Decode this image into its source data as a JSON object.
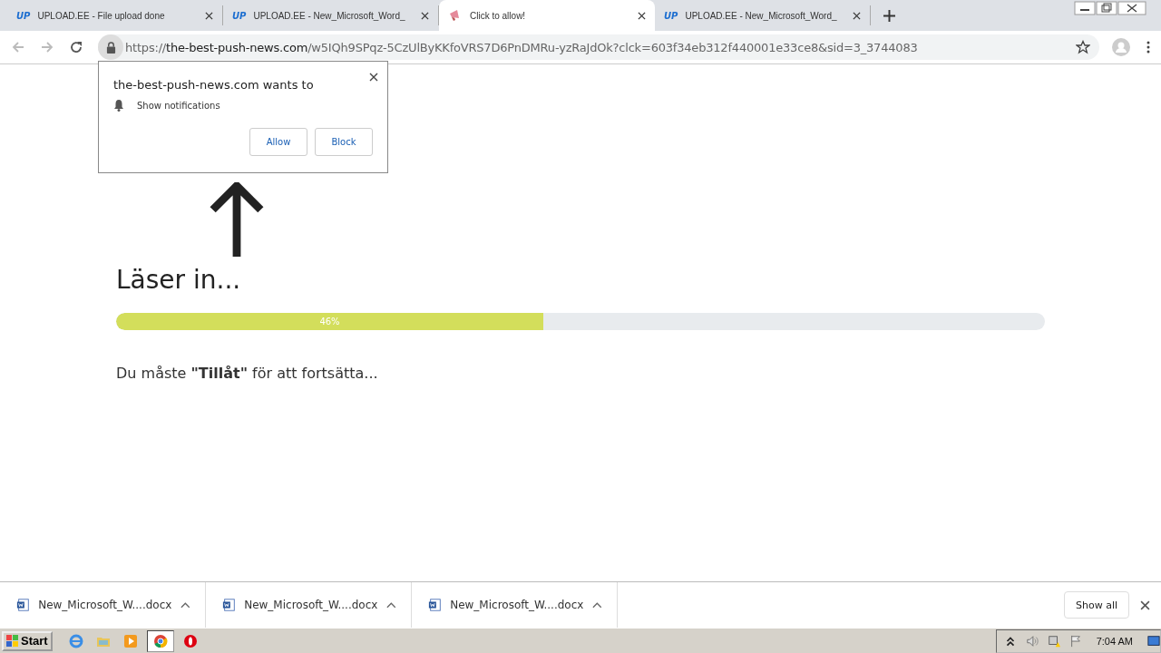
{
  "tabs": [
    {
      "badge": "UP",
      "title": "UPLOAD.EE - File upload done",
      "selected": false
    },
    {
      "badge": "UP",
      "title": "UPLOAD.EE - New_Microsoft_Word_",
      "selected": false
    },
    {
      "title": "Click to allow!",
      "selected": true
    },
    {
      "badge": "UP",
      "title": "UPLOAD.EE - New_Microsoft_Word_",
      "selected": false
    }
  ],
  "address_bar": {
    "scheme": "https://",
    "host": "the-best-push-news.com",
    "path": "/w5IQh9SPqz-5CzUlByKKfoVRS7D6PnDMRu-yzRaJdOk?clck=603f34eb312f440001e33ce8&sid=3_3744083"
  },
  "permission_prompt": {
    "title": "the-best-push-news.com wants to",
    "permission": "Show notifications",
    "buttons": [
      "Allow",
      "Block"
    ]
  },
  "page": {
    "heading": "Läser in...",
    "progress": {
      "level": 0.46,
      "label": "46%"
    },
    "message": "Du måste **\"Tillåt\"** för att fortsätta..."
  },
  "downloads": [
    {
      "filename": "New_Microsoft_W....docx"
    },
    {
      "filename": "New_Microsoft_W....docx"
    },
    {
      "filename": "New_Microsoft_W....docx"
    }
  ],
  "download_shelf": {
    "show_all": "Show all"
  },
  "taskbar": {
    "start": "Start",
    "clock": "7:04 AM"
  }
}
